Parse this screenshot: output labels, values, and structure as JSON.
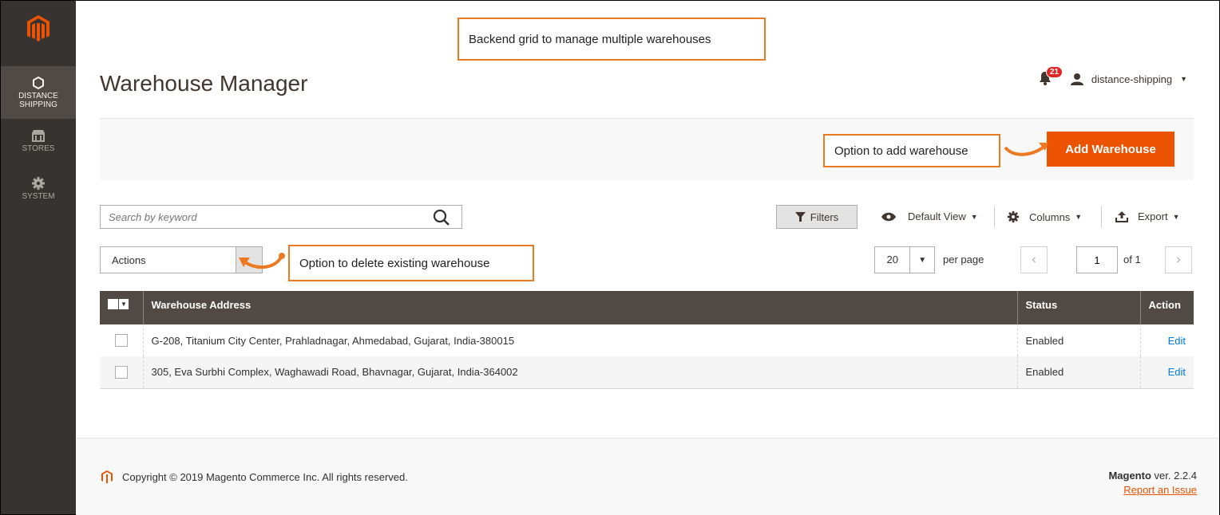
{
  "sidebar": {
    "items": [
      {
        "label_1": "DISTANCE",
        "label_2": "SHIPPING",
        "icon": "hexagon-icon"
      },
      {
        "label_1": "STORES",
        "label_2": "",
        "icon": "store-icon"
      },
      {
        "label_1": "SYSTEM",
        "label_2": "",
        "icon": "gear-icon"
      }
    ]
  },
  "header": {
    "title": "Warehouse Manager",
    "notifications_count": "21",
    "user_name": "distance-shipping"
  },
  "callouts": {
    "top": "Backend grid to manage multiple warehouses",
    "add": "Option to add warehouse",
    "delete": "Option to delete existing warehouse"
  },
  "page_actions": {
    "add_button": "Add Warehouse"
  },
  "toolbar": {
    "search_placeholder": "Search by keyword",
    "filters": "Filters",
    "default_view": "Default View",
    "columns": "Columns",
    "export": "Export",
    "actions": "Actions",
    "per_page_value": "20",
    "per_page_label": "per page",
    "current_page": "1",
    "of_pages": "of 1"
  },
  "grid": {
    "columns": [
      "Warehouse Address",
      "Status",
      "Action"
    ],
    "rows": [
      {
        "address": "G-208, Titanium City Center, Prahladnagar, Ahmedabad, Gujarat, India-380015",
        "status": "Enabled",
        "action": "Edit"
      },
      {
        "address": "305, Eva Surbhi Complex, Waghawadi Road, Bhavnagar, Gujarat, India-364002",
        "status": "Enabled",
        "action": "Edit"
      }
    ]
  },
  "footer": {
    "copyright": "Copyright © 2019 Magento Commerce Inc. All rights reserved.",
    "brand": "Magento",
    "version": "ver. 2.2.4",
    "report": "Report an Issue"
  },
  "colors": {
    "accent": "#eb5202",
    "callout_border": "#eb7a22",
    "sidebar_bg": "#373330",
    "grid_header_bg": "#514943",
    "link": "#007bdb"
  }
}
